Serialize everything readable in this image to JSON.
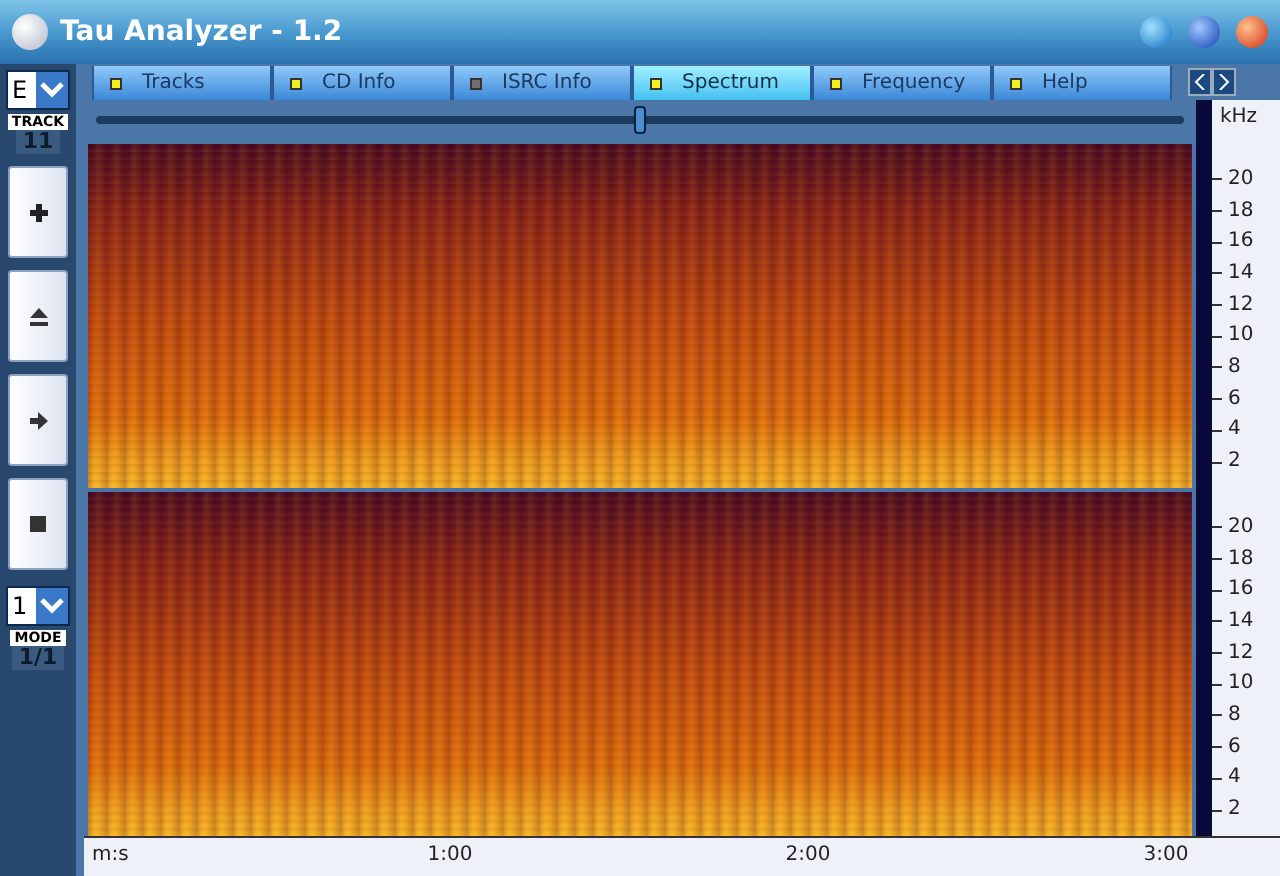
{
  "window": {
    "title": "Tau Analyzer - 1.2"
  },
  "tabs": [
    {
      "label": "Tracks",
      "selected": false,
      "on": true
    },
    {
      "label": "CD Info",
      "selected": false,
      "on": true
    },
    {
      "label": "ISRC Info",
      "selected": false,
      "on": false
    },
    {
      "label": "Spectrum",
      "selected": true,
      "on": true
    },
    {
      "label": "Frequency",
      "selected": false,
      "on": true
    },
    {
      "label": "Help",
      "selected": false,
      "on": true
    }
  ],
  "position_slider": {
    "level": 0.5
  },
  "drive": {
    "value": "E",
    "label": "TRACK",
    "track": "11"
  },
  "mode": {
    "value": "1",
    "label": "MODE",
    "reading": "1/1"
  },
  "freq_axis": {
    "unit": "kHz",
    "channels": [
      [
        "20",
        "18",
        "16",
        "14",
        "12",
        "10",
        "8",
        "6",
        "4",
        "2"
      ],
      [
        "20",
        "18",
        "16",
        "14",
        "12",
        "10",
        "8",
        "6",
        "4",
        "2"
      ]
    ]
  },
  "time_axis": [
    "m:s",
    "1:00",
    "2:00",
    "3:00"
  ]
}
